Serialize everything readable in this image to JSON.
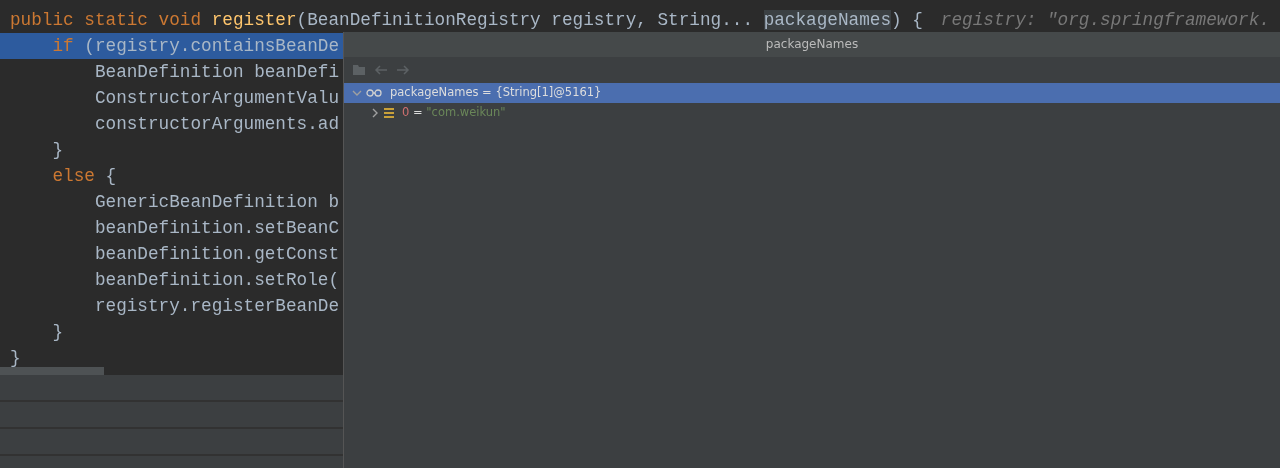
{
  "editor": {
    "lines": [
      {
        "highlighted": false,
        "tokens": [
          {
            "text": "public static void ",
            "kind": "keyword"
          },
          {
            "text": "register",
            "kind": "method"
          },
          {
            "text": "(BeanDefinitionRegistry registry, String... ",
            "kind": "plain"
          },
          {
            "text": "packageNames",
            "kind": "usage"
          },
          {
            "text": ") {",
            "kind": "plain"
          }
        ],
        "hint": "registry: \"org.springframework."
      },
      {
        "highlighted": true,
        "tokens": [
          {
            "text": "    if",
            "kind": "keyword"
          },
          {
            "text": " (registry.containsBeanDe",
            "kind": "plain"
          }
        ]
      },
      {
        "highlighted": false,
        "tokens": [
          {
            "text": "        BeanDefinition beanDefi",
            "kind": "plain"
          }
        ]
      },
      {
        "highlighted": false,
        "tokens": [
          {
            "text": "        ConstructorArgumentValu",
            "kind": "plain"
          }
        ]
      },
      {
        "highlighted": false,
        "tokens": [
          {
            "text": "        constructorArguments.ad",
            "kind": "plain"
          }
        ]
      },
      {
        "highlighted": false,
        "tokens": [
          {
            "text": "    }",
            "kind": "plain"
          }
        ]
      },
      {
        "highlighted": false,
        "tokens": [
          {
            "text": "    else",
            "kind": "keyword"
          },
          {
            "text": " {",
            "kind": "plain"
          }
        ]
      },
      {
        "highlighted": false,
        "tokens": [
          {
            "text": "        GenericBeanDefinition b",
            "kind": "plain"
          }
        ]
      },
      {
        "highlighted": false,
        "tokens": [
          {
            "text": "        beanDefinition.setBeanC",
            "kind": "plain"
          }
        ]
      },
      {
        "highlighted": false,
        "tokens": [
          {
            "text": "        beanDefinition.getConst",
            "kind": "plain"
          }
        ]
      },
      {
        "highlighted": false,
        "tokens": [
          {
            "text": "        beanDefinition.setRole(",
            "kind": "plain"
          }
        ]
      },
      {
        "highlighted": false,
        "tokens": [
          {
            "text": "        registry.registerBeanDe",
            "kind": "plain"
          }
        ]
      },
      {
        "highlighted": false,
        "tokens": [
          {
            "text": "    }",
            "kind": "plain"
          }
        ]
      },
      {
        "highlighted": false,
        "tokens": [
          {
            "text": "}",
            "kind": "plain"
          }
        ]
      }
    ]
  },
  "popup": {
    "title": "packageNames",
    "tree": [
      {
        "name": "packageNames",
        "separator": "=",
        "value": "{String[1]@5161}",
        "kind": "array",
        "expanded": true,
        "selected": true,
        "children": [
          {
            "name": "0",
            "separator": "=",
            "value": "\"com.weikun\"",
            "kind": "element",
            "expanded": false,
            "selected": false
          }
        ]
      }
    ]
  }
}
